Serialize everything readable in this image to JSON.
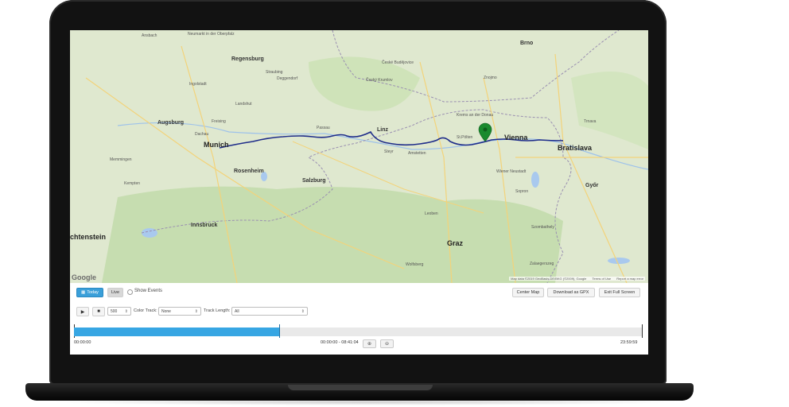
{
  "map": {
    "labels": {
      "ansbach": "Ansbach",
      "neumarkt": "Neumarkt in der Oberpfalz",
      "regensburg": "Regensburg",
      "straubing": "Straubing",
      "deggendorf": "Deggendorf",
      "ingolstadt": "Ingolstadt",
      "landshut": "Landshut",
      "augsburg": "Augsburg",
      "dachau": "Dachau",
      "munich": "Munich",
      "freising": "Freising",
      "rosenheim": "Rosenheim",
      "salzburg": "Salzburg",
      "innsbruck": "Innsbruck",
      "liechtenstein": "chtenstein",
      "linz": "Linz",
      "steyr": "Steyr",
      "amstetten": "Amstetten",
      "stpolten": "St.Pölten",
      "vienna": "Vienna",
      "bratislava": "Bratislava",
      "brno": "Brno",
      "ceske_budejovice": "České Budějovice",
      "cesky_krumlov": "Český Krumlov",
      "znojmo": "Znojmo",
      "graz": "Graz",
      "leoben": "Leoben",
      "wiener_neustadt": "Wiener Neustadt",
      "sopron": "Sopron",
      "gyor": "Győr",
      "trnava": "Trnava",
      "passau": "Passau",
      "kempten": "Kempten",
      "memmingen": "Memmingen",
      "szombathely": "Szombathely",
      "wolfsberg": "Wolfsberg",
      "zalaegerszeg": "Zalaegerszeg",
      "krems": "Krems an der Donau"
    },
    "google_logo": "Google",
    "attribution": "Map data ©2019 GeoBasis-DE/BKG (©2009), Google",
    "terms": "Terms of Use",
    "report": "Report a map error",
    "colors": {
      "route": "#1f2d8a",
      "marker": "#1a8a2e",
      "land": "#dfe8cf",
      "forest": "#c4dcae"
    }
  },
  "controls": {
    "today_label": "Today",
    "live_label": "Live",
    "show_events_label": "Show Events",
    "center_map_label": "Center Map",
    "download_gpx_label": "Download as GPX",
    "exit_fullscreen_label": "Exit Full Screen",
    "play_icon": "play-icon",
    "stop_icon": "stop-icon",
    "speed_value": "500",
    "color_track_label": "Color Track:",
    "color_track_value": "None",
    "track_length_label": "Track Length:",
    "track_length_value": "All"
  },
  "timeline": {
    "start_time": "00:00:00",
    "end_time": "23:59:59",
    "range_text": "00:00:00 - 08:41:04",
    "progress_fraction": 0.362
  }
}
